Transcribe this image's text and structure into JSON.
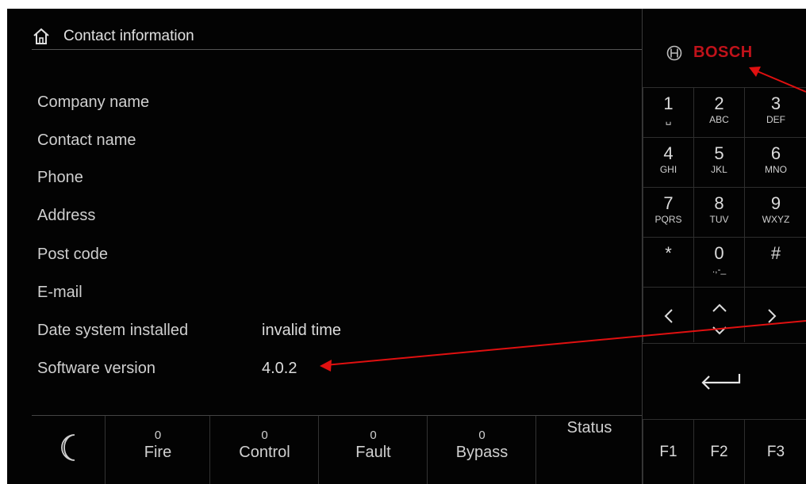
{
  "header": {
    "title": "Contact information",
    "icon": "home-icon"
  },
  "brand": {
    "name": "BOSCH",
    "color": "#c0121a"
  },
  "fields": [
    {
      "label": "Company name",
      "value": ""
    },
    {
      "label": "Contact name",
      "value": ""
    },
    {
      "label": "Phone",
      "value": ""
    },
    {
      "label": "Address",
      "value": ""
    },
    {
      "label": "Post code",
      "value": ""
    },
    {
      "label": "E-mail",
      "value": ""
    },
    {
      "label": "Date system installed",
      "value": "invalid time"
    },
    {
      "label": "Software version",
      "value": "4.0.2"
    }
  ],
  "status_bar": {
    "night_icon": "moon-icon",
    "items": [
      {
        "count": "0",
        "label": "Fire"
      },
      {
        "count": "0",
        "label": "Control"
      },
      {
        "count": "0",
        "label": "Fault"
      },
      {
        "count": "0",
        "label": "Bypass"
      },
      {
        "count": "",
        "label": "Status"
      }
    ]
  },
  "keypad": {
    "keys": [
      {
        "digit": "1",
        "letters": "␣"
      },
      {
        "digit": "2",
        "letters": "ABC"
      },
      {
        "digit": "3",
        "letters": "DEF"
      },
      {
        "digit": "4",
        "letters": "GHI"
      },
      {
        "digit": "5",
        "letters": "JKL"
      },
      {
        "digit": "6",
        "letters": "MNO"
      },
      {
        "digit": "7",
        "letters": "PQRS"
      },
      {
        "digit": "8",
        "letters": "TUV"
      },
      {
        "digit": "9",
        "letters": "WXYZ"
      },
      {
        "digit": "*",
        "letters": ""
      },
      {
        "digit": "0",
        "letters": ".,-_"
      },
      {
        "digit": "#",
        "letters": ""
      }
    ],
    "nav": [
      "left-arrow-icon",
      "up-down-arrow-icon",
      "right-arrow-icon"
    ],
    "enter_icon": "enter-icon",
    "function_keys": [
      "F1",
      "F2",
      "F3"
    ]
  },
  "annotation_color": "#e01010"
}
